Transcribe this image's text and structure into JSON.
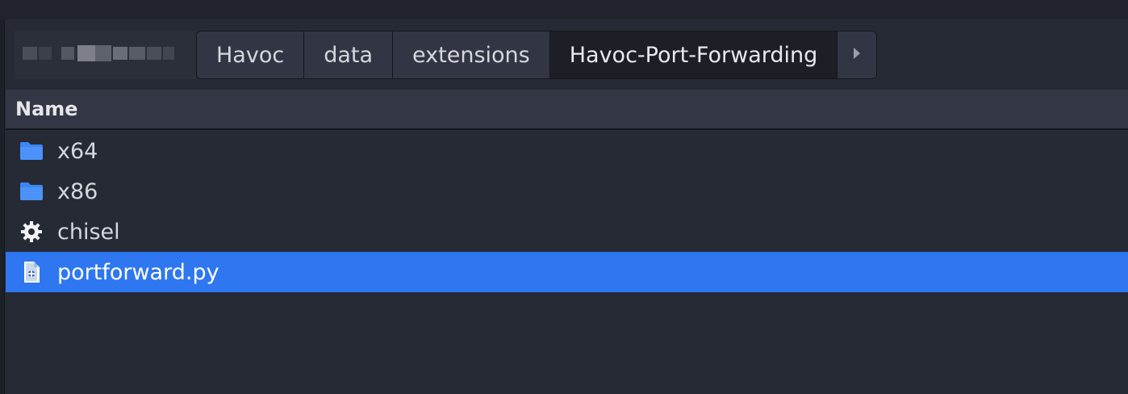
{
  "pathbar": {
    "crumbs": [
      {
        "label": "Havoc"
      },
      {
        "label": "data"
      },
      {
        "label": "extensions"
      },
      {
        "label": "Havoc-Port-Forwarding"
      }
    ]
  },
  "list": {
    "header": {
      "name_label": "Name"
    },
    "rows": [
      {
        "name": "x64",
        "icon": "folder-icon"
      },
      {
        "name": "x86",
        "icon": "folder-icon"
      },
      {
        "name": "chisel",
        "icon": "executable-gear-icon"
      },
      {
        "name": "portforward.py",
        "icon": "python-script-icon",
        "selected": true
      }
    ]
  },
  "colors": {
    "background": "#262a35",
    "selection": "#2f77f0",
    "folder": "#3d86f5"
  }
}
